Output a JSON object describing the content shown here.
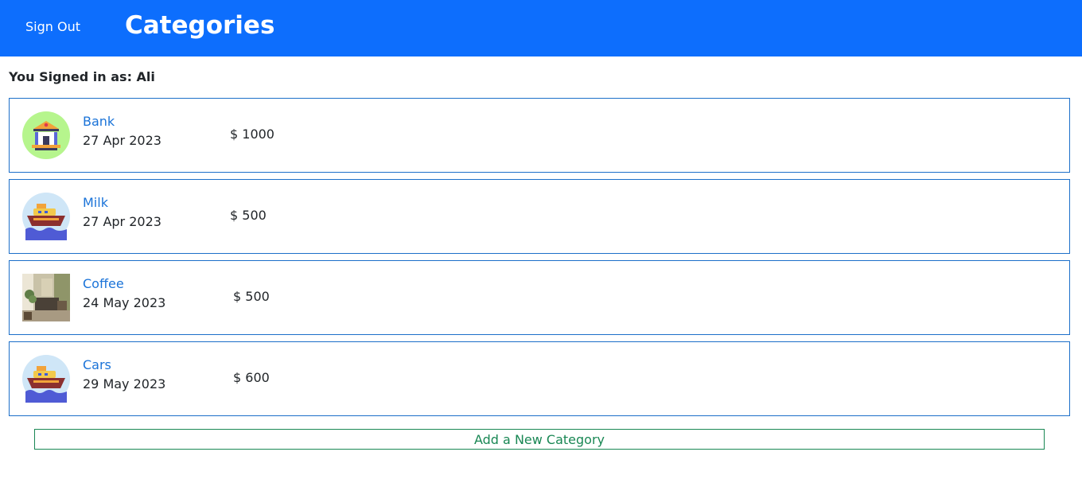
{
  "header": {
    "signout_label": "Sign Out",
    "title": "Categories"
  },
  "user": {
    "signed_in_text": "You Signed in as: Ali"
  },
  "categories": [
    {
      "name": "Bank",
      "date": "27 Apr 2023",
      "amount": "$ 1000",
      "icon": "bank-icon"
    },
    {
      "name": "Milk",
      "date": "27 Apr 2023",
      "amount": "$ 500",
      "icon": "ship-icon"
    },
    {
      "name": "Coffee",
      "date": "24 May 2023",
      "amount": "$ 500",
      "icon": "room-photo"
    },
    {
      "name": "Cars",
      "date": "29 May 2023",
      "amount": "$ 600",
      "icon": "ship-icon"
    }
  ],
  "actions": {
    "add_label": "Add a New Category"
  },
  "colors": {
    "header": "#0d6efd",
    "card_border": "#1c6fc9",
    "link": "#1a73d8",
    "add": "#198754"
  }
}
